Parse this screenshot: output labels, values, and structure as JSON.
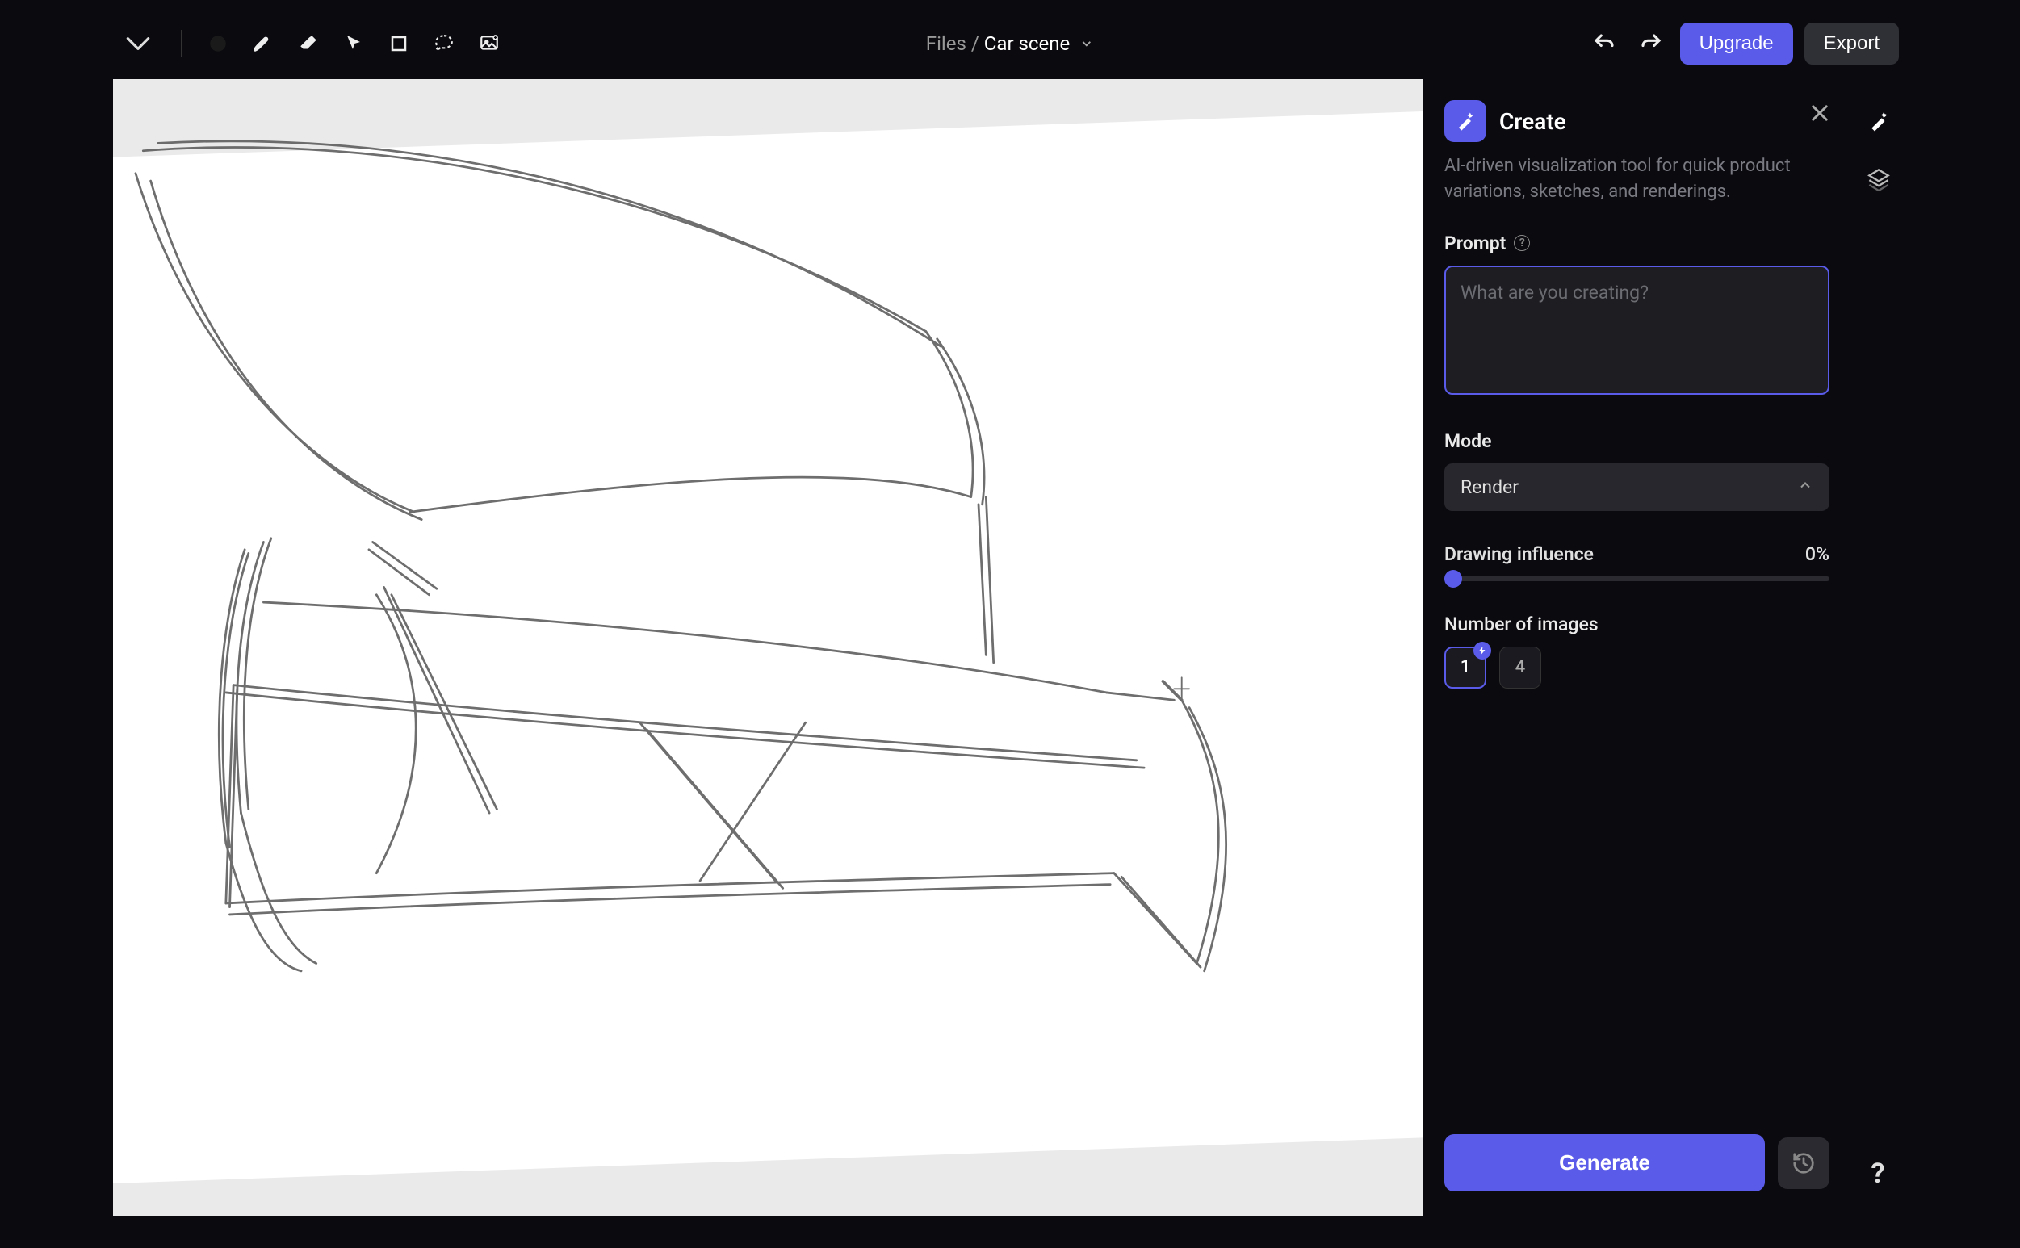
{
  "breadcrumb": {
    "root": "Files",
    "separator": "/",
    "current": "Car scene"
  },
  "toolbar": {
    "tools": [
      "color",
      "brush",
      "eraser",
      "pointer",
      "rectangle",
      "lasso",
      "image"
    ]
  },
  "actions": {
    "upgrade": "Upgrade",
    "export": "Export"
  },
  "panel": {
    "title": "Create",
    "description": "AI-driven visualization tool for quick product variations, sketches, and renderings.",
    "prompt_label": "Prompt",
    "prompt_placeholder": "What are you creating?",
    "prompt_value": "",
    "mode_label": "Mode",
    "mode_value": "Render",
    "influence_label": "Drawing influence",
    "influence_value": "0%",
    "num_images_label": "Number of images",
    "num_options": [
      "1",
      "4"
    ],
    "num_selected": "1",
    "generate": "Generate"
  },
  "colors": {
    "accent": "#5b5bea",
    "bg": "#0a0a0f",
    "panel": "#1d1d22"
  }
}
